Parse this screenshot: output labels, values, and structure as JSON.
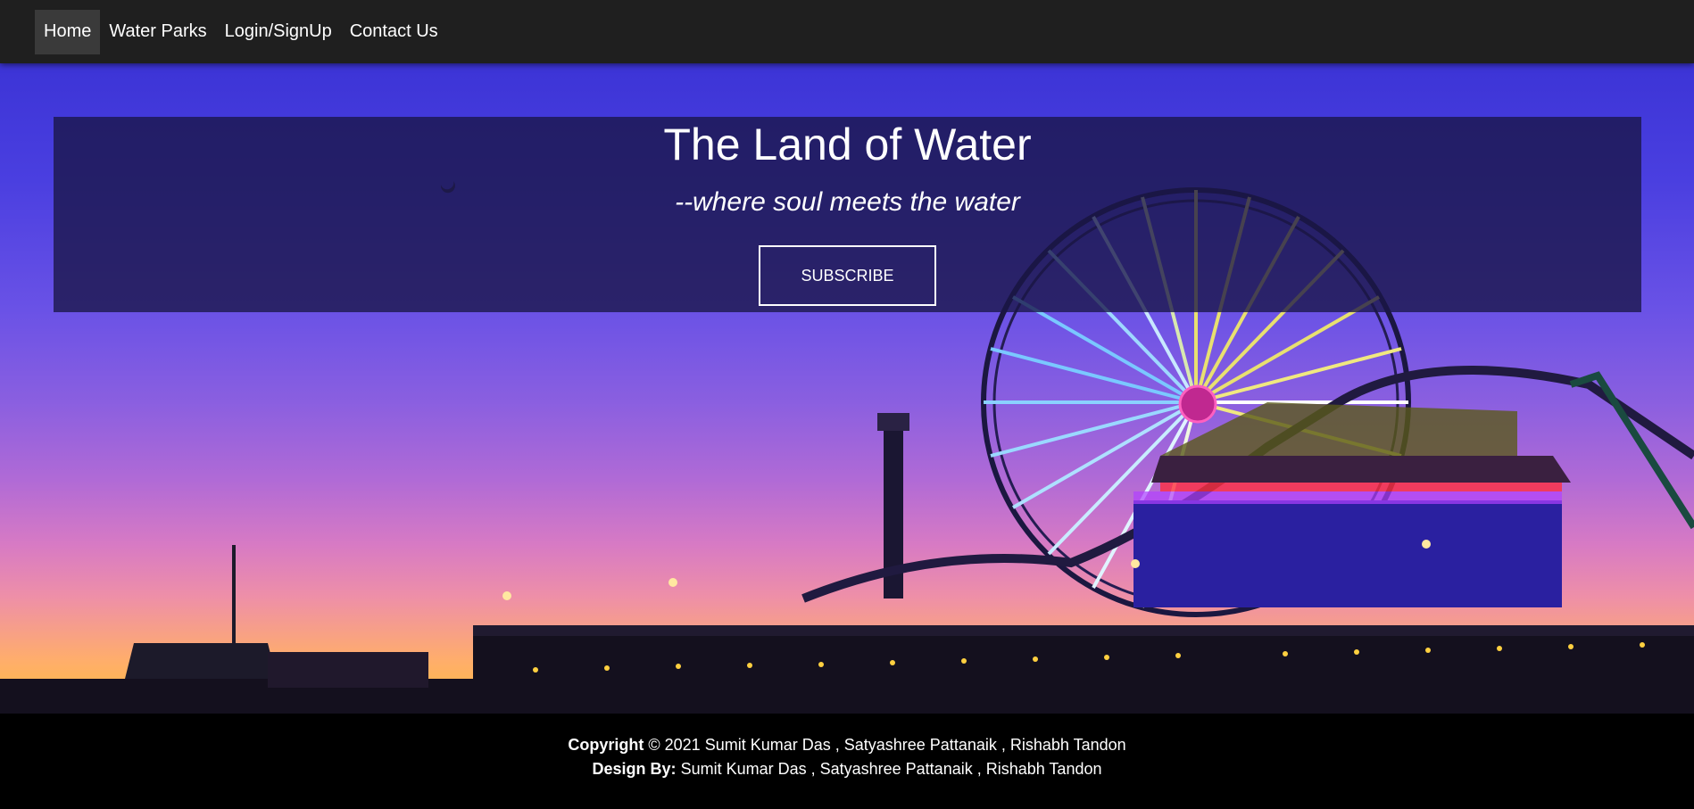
{
  "nav": {
    "items": [
      {
        "label": "Home",
        "active": true
      },
      {
        "label": "Water Parks",
        "active": false
      },
      {
        "label": "Login/SignUp",
        "active": false
      },
      {
        "label": "Contact Us",
        "active": false
      }
    ]
  },
  "hero": {
    "title": "The Land of Water",
    "subtitle": "--where soul meets the water",
    "subscribe_label": "SUBSCRIBE"
  },
  "footer": {
    "copyright_label": "Copyright",
    "copyright_text": "© 2021 Sumit Kumar Das , Satyashree Pattanaik , Rishabh Tandon",
    "design_label": "Design By:",
    "design_text": "Sumit Kumar Das , Satyashree Pattanaik , Rishabh Tandon"
  },
  "colors": {
    "navbar_bg": "#1f1f1f",
    "active_nav_bg": "#3a3a3a",
    "banner_overlay": "#191646",
    "footer_bg": "#000000"
  }
}
